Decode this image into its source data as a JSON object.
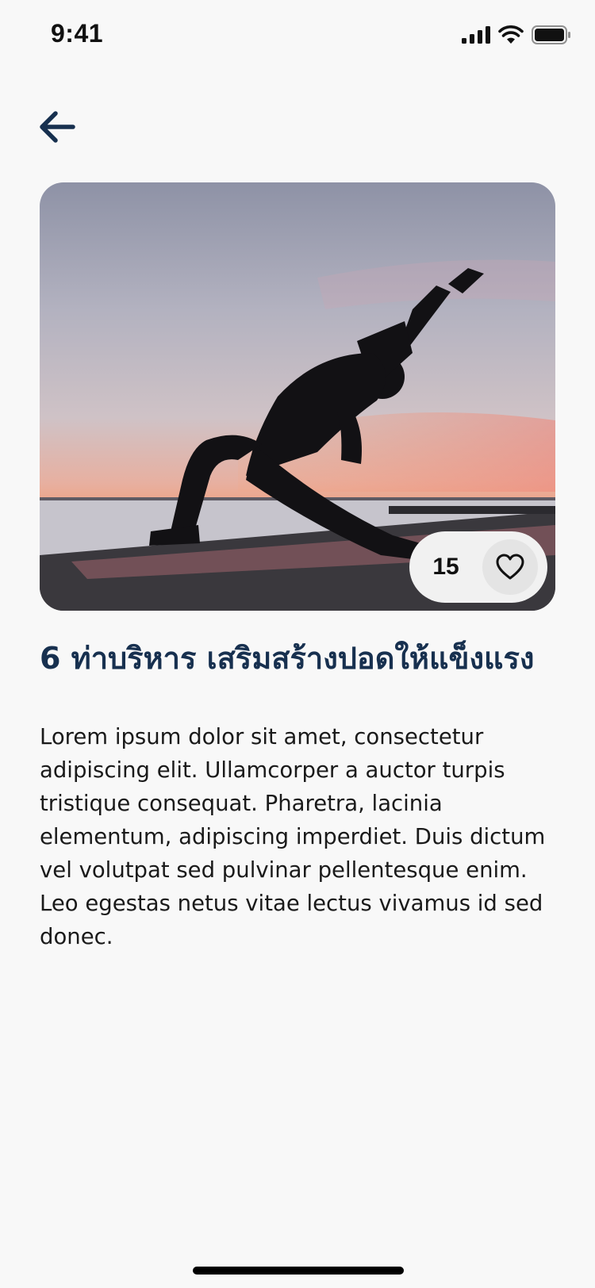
{
  "status_bar": {
    "time": "9:41",
    "icons": [
      "signal-icon",
      "wifi-icon",
      "battery-icon"
    ]
  },
  "nav": {
    "back_icon": "arrow-left-icon"
  },
  "post": {
    "image_alt": "Yoga pose at sunset by the sea",
    "likes": "15",
    "like_icon": "heart-outline-icon",
    "title": "6 ท่าบริหาร เสริมสร้างปอดให้แข็งแรง",
    "body": "Lorem ipsum dolor sit amet, consectetur adipiscing elit. Ullamcorper a auctor turpis tristique consequat. Pharetra, lacinia elementum, adipiscing imperdiet. Duis dictum vel volutpat sed pulvinar pellentesque enim. Leo egestas netus vitae lectus vivamus id sed donec."
  },
  "colors": {
    "background": "#f8f8f8",
    "title": "#17304f",
    "text": "#1a1a1a",
    "pill": "#f1f1f1"
  }
}
